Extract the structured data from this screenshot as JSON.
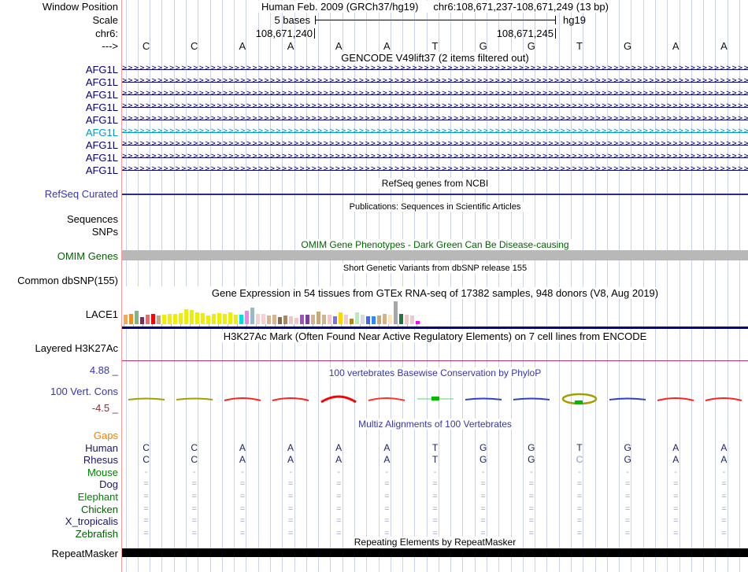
{
  "colors": {
    "grid": "#c9d3f0",
    "left_border": "#ff9a9a",
    "navy": "#000080",
    "gene_alt": "#0099cc",
    "refseq_line": "#2a2a90",
    "omim_green": "#006400",
    "omim_bar": "#b8b8b8",
    "gtex_base": "#000080",
    "h3k27_line": "#c83060",
    "cons_blue": "#3636b0",
    "cons_min_red": "#8b3030",
    "gaps_orange": "#f08000",
    "align_letter": "#1b2468",
    "align_faint": "#98a6d6",
    "mismatch": "#8c9ccc",
    "black_bar": "#000000",
    "tick": "#b8aee0"
  },
  "header": {
    "window_position_label": "Window Position",
    "assembly": "Human Feb. 2009 (GRCh37/hg19)",
    "position": "chr6:108,671,237-108,671,249 (13 bp)",
    "scale_label": "Scale",
    "scale_value": "5 bases",
    "scale_right": "hg19",
    "chrom_label": "chr6:",
    "coord_left": "108,671,240",
    "coord_right": "108,671,245",
    "strand_label": "--->"
  },
  "sequence": [
    "C",
    "C",
    "A",
    "A",
    "A",
    "A",
    "T",
    "G",
    "G",
    "T",
    "G",
    "A",
    "A"
  ],
  "gencode": {
    "title": "GENCODE V49lift37 (2 items filtered out)",
    "arrow_char": ">",
    "gene_rows": [
      {
        "label": "AFG1L",
        "color": "#000080"
      },
      {
        "label": "AFG1L",
        "color": "#000080"
      },
      {
        "label": "AFG1L",
        "color": "#000080"
      },
      {
        "label": "AFG1L",
        "color": "#000080"
      },
      {
        "label": "AFG1L",
        "color": "#000080"
      },
      {
        "label": "AFG1L",
        "color": "#0099cc"
      },
      {
        "label": "AFG1L",
        "color": "#000080"
      },
      {
        "label": "AFG1L",
        "color": "#000080"
      },
      {
        "label": "AFG1L",
        "color": "#000080"
      }
    ]
  },
  "refseq": {
    "title": "RefSeq genes from NCBI",
    "label": "RefSeq Curated",
    "label_color": "#3838a8"
  },
  "publications": {
    "title": "Publications: Sequences in Scientific Articles"
  },
  "sequences_label": "Sequences",
  "snps_label": "SNPs",
  "omim": {
    "title": "OMIM Gene Phenotypes - Dark Green Can Be Disease-causing",
    "label": "OMIM Genes"
  },
  "dbsnp": {
    "title": "Short Genetic Variants from dbSNP release 155",
    "label": "Common dbSNP(155)"
  },
  "gtex": {
    "title": "Gene Expression in 54 tissues from GTEx RNA-seq of 17382 samples, 948 donors (V8, Aug 2019)",
    "label": "LACE1",
    "bars": [
      {
        "c": "#ffa54f",
        "h": 12
      },
      {
        "c": "#ee9022",
        "h": 13
      },
      {
        "c": "#7fb87f",
        "h": 17
      },
      {
        "c": "#7a2f5f",
        "h": 9
      },
      {
        "c": "#ee6a6a",
        "h": 12
      },
      {
        "c": "#ff0000",
        "h": 13
      },
      {
        "c": "#c9a189",
        "h": 11
      },
      {
        "c": "#eeee00",
        "h": 12
      },
      {
        "c": "#eeee00",
        "h": 13
      },
      {
        "c": "#eeee00",
        "h": 13
      },
      {
        "c": "#eeee00",
        "h": 14
      },
      {
        "c": "#eeee00",
        "h": 19
      },
      {
        "c": "#eeee00",
        "h": 18
      },
      {
        "c": "#eeee00",
        "h": 15
      },
      {
        "c": "#eeee00",
        "h": 14
      },
      {
        "c": "#eeee00",
        "h": 11
      },
      {
        "c": "#eeee00",
        "h": 13
      },
      {
        "c": "#eeee00",
        "h": 14
      },
      {
        "c": "#eeee00",
        "h": 13
      },
      {
        "c": "#eeee00",
        "h": 15
      },
      {
        "c": "#eeee00",
        "h": 12
      },
      {
        "c": "#00dddd",
        "h": 12
      },
      {
        "c": "#ee82ee",
        "h": 17
      },
      {
        "c": "#9ab8c8",
        "h": 21
      },
      {
        "c": "#f5d0d0",
        "h": 13
      },
      {
        "c": "#f5d0d0",
        "h": 13
      },
      {
        "c": "#d9b48f",
        "h": 11
      },
      {
        "c": "#d9b48f",
        "h": 12
      },
      {
        "c": "#8a6a50",
        "h": 9
      },
      {
        "c": "#a98860",
        "h": 11
      },
      {
        "c": "#eec8c8",
        "h": 10
      },
      {
        "c": "#eec8c8",
        "h": 8
      },
      {
        "c": "#a050c8",
        "h": 12
      },
      {
        "c": "#7a3fa0",
        "h": 12
      },
      {
        "c": "#d2b48c",
        "h": 12
      },
      {
        "c": "#c8a878",
        "h": 16
      },
      {
        "c": "#d2b48c",
        "h": 12
      },
      {
        "c": "#f0c8c8",
        "h": 12
      },
      {
        "c": "#8070d8",
        "h": 10
      },
      {
        "c": "#ffd700",
        "h": 15
      },
      {
        "c": "#f5c8d0",
        "h": 12
      },
      {
        "c": "#b8860b",
        "h": 7
      },
      {
        "c": "#b4eeb4",
        "h": 15
      },
      {
        "c": "#d9d9d9",
        "h": 12
      },
      {
        "c": "#4169e1",
        "h": 10
      },
      {
        "c": "#3388ff",
        "h": 10
      },
      {
        "c": "#c8a878",
        "h": 11
      },
      {
        "c": "#d2b48c",
        "h": 13
      },
      {
        "c": "#ffe4b5",
        "h": 12
      },
      {
        "c": "#a6a6a6",
        "h": 29
      },
      {
        "c": "#1a7a40",
        "h": 13
      },
      {
        "c": "#eec8c8",
        "h": 12
      },
      {
        "c": "#eec8c8",
        "h": 11
      },
      {
        "c": "#ff00ff",
        "h": 4
      }
    ]
  },
  "h3k27ac": {
    "title": "H3K27Ac Mark (Often Found Near Active Regulatory Elements) on 7 cell lines from ENCODE",
    "label": "Layered H3K27Ac"
  },
  "conservation": {
    "title": "100 vertebrates Basewise Conservation by PhyloP",
    "label": "100 Vert. Cons",
    "max_label": "4.88 _",
    "min_label": "-4.5 _",
    "marks": [
      {
        "t": "flat",
        "c": "#a0a000"
      },
      {
        "t": "flat",
        "c": "#a0a000"
      },
      {
        "t": "bump",
        "c": "#ff2020"
      },
      {
        "t": "bump",
        "c": "#ff2020"
      },
      {
        "t": "arch",
        "c": "#ff0000"
      },
      {
        "t": "bump",
        "c": "#ff3030"
      },
      {
        "t": "dot",
        "c": "#00bb00",
        "c2": "#99dd99"
      },
      {
        "t": "flat",
        "c": "#3040c0"
      },
      {
        "t": "flat",
        "c": "#3040c0"
      },
      {
        "t": "loop",
        "c": "#a0a000",
        "c2": "#00bb00"
      },
      {
        "t": "flat",
        "c": "#3040c0"
      },
      {
        "t": "bump",
        "c": "#ff2020"
      },
      {
        "t": "bump",
        "c": "#ff2020"
      }
    ]
  },
  "multiz": {
    "title": "Multiz Alignments of 100 Vertebrates",
    "rows": [
      {
        "label": "Gaps",
        "label_color": "#f08000",
        "cells": "",
        "cell_color": ""
      },
      {
        "label": "Human",
        "label_color": "#16166e",
        "cells": "CCAAAATGGTGAA",
        "cell_color": "#1b2468",
        "cell_size": 12
      },
      {
        "label": "Rhesus",
        "label_color": "#16166e",
        "cells": "CCAAAATGGCGAA",
        "cell_color": "#1b2468",
        "cell_size": 12,
        "light": [
          9
        ]
      },
      {
        "label": "Mouse",
        "label_color": "#008000",
        "cells": "-------------",
        "cell_color": "#98a6d6",
        "cell_size": 11
      },
      {
        "label": "Dog",
        "label_color": "#16166e",
        "cells": "=============",
        "cell_color": "#98a6d6",
        "cell_size": 11
      },
      {
        "label": "Elephant",
        "label_color": "#008000",
        "cells": "=============",
        "cell_color": "#98a6d6",
        "cell_size": 11
      },
      {
        "label": "Chicken",
        "label_color": "#006000",
        "cells": "=============",
        "cell_color": "#98a6d6",
        "cell_size": 11
      },
      {
        "label": "X_tropicalis",
        "label_color": "#16166e",
        "cells": "=============",
        "cell_color": "#98a6d6",
        "cell_size": 11
      },
      {
        "label": "Zebrafish",
        "label_color": "#006000",
        "cells": "=============",
        "cell_color": "#98a6d6",
        "cell_size": 11
      }
    ]
  },
  "repeatmasker": {
    "title": "Repeating Elements by RepeatMasker",
    "label": "RepeatMasker"
  }
}
